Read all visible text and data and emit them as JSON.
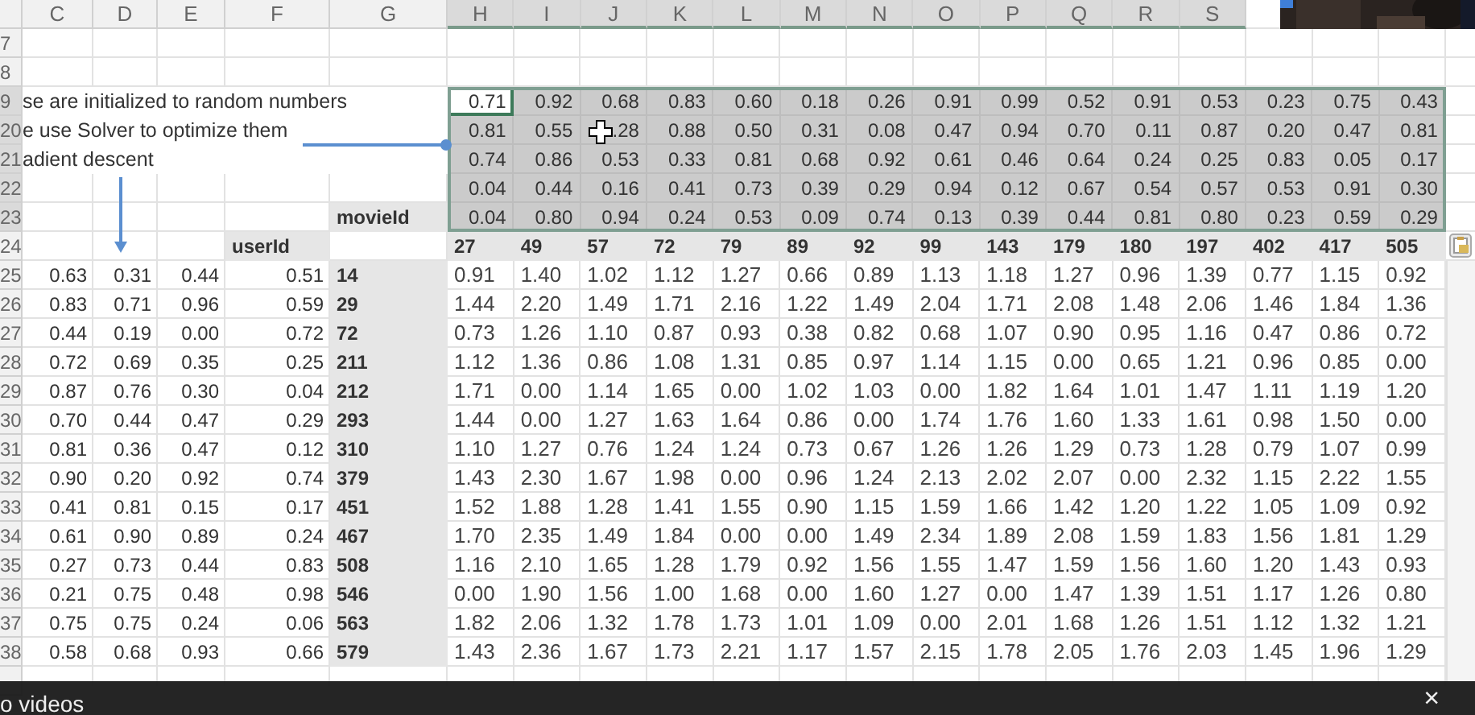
{
  "sheet": {
    "column_headers": [
      {
        "label": "C",
        "highlighted": false
      },
      {
        "label": "D",
        "highlighted": false
      },
      {
        "label": "E",
        "highlighted": false
      },
      {
        "label": "F",
        "highlighted": false
      },
      {
        "label": "G",
        "highlighted": false
      },
      {
        "label": "H",
        "highlighted": true
      },
      {
        "label": "I",
        "highlighted": true
      },
      {
        "label": "J",
        "highlighted": true
      },
      {
        "label": "K",
        "highlighted": true
      },
      {
        "label": "L",
        "highlighted": true
      },
      {
        "label": "M",
        "highlighted": true
      },
      {
        "label": "N",
        "highlighted": true
      },
      {
        "label": "O",
        "highlighted": true
      },
      {
        "label": "P",
        "highlighted": true
      },
      {
        "label": "Q",
        "highlighted": true
      },
      {
        "label": "R",
        "highlighted": true
      },
      {
        "label": "S",
        "highlighted": true
      }
    ],
    "row_headers": [
      {
        "label": "7",
        "highlighted": false
      },
      {
        "label": "8",
        "highlighted": false
      },
      {
        "label": "9",
        "highlighted": true
      },
      {
        "label": "20",
        "highlighted": true
      },
      {
        "label": "21",
        "highlighted": true
      },
      {
        "label": "22",
        "highlighted": true
      },
      {
        "label": "23",
        "highlighted": true
      },
      {
        "label": "24",
        "highlighted": false
      },
      {
        "label": "25",
        "highlighted": false
      },
      {
        "label": "26",
        "highlighted": false
      },
      {
        "label": "27",
        "highlighted": false
      },
      {
        "label": "28",
        "highlighted": false
      },
      {
        "label": "29",
        "highlighted": false
      },
      {
        "label": "30",
        "highlighted": false
      },
      {
        "label": "31",
        "highlighted": false
      },
      {
        "label": "32",
        "highlighted": false
      },
      {
        "label": "33",
        "highlighted": false
      },
      {
        "label": "34",
        "highlighted": false
      },
      {
        "label": "35",
        "highlighted": false
      },
      {
        "label": "36",
        "highlighted": false
      },
      {
        "label": "37",
        "highlighted": false
      },
      {
        "label": "38",
        "highlighted": false
      }
    ],
    "notes": [
      "se are initialized to random numbers",
      "e use Solver to optimize them",
      "adient descent"
    ],
    "movie_factor_rows": [
      [
        {
          "value": "0.71",
          "selected": true
        },
        {
          "value": "0.92",
          "selected": false
        },
        {
          "value": "0.68",
          "selected": false
        },
        {
          "value": "0.83",
          "selected": false
        },
        {
          "value": "0.60",
          "selected": false
        },
        {
          "value": "0.18",
          "selected": false
        },
        {
          "value": "0.26",
          "selected": false
        },
        {
          "value": "0.91",
          "selected": false
        },
        {
          "value": "0.99",
          "selected": false
        },
        {
          "value": "0.52",
          "selected": false
        },
        {
          "value": "0.91",
          "selected": false
        },
        {
          "value": "0.53",
          "selected": false
        },
        {
          "value": "0.23",
          "selected": false
        },
        {
          "value": "0.75",
          "selected": false
        },
        {
          "value": "0.43",
          "selected": false
        }
      ],
      [
        {
          "value": "0.81",
          "selected": false
        },
        {
          "value": "0.55",
          "selected": false
        },
        {
          "value": ".28",
          "selected": false
        },
        {
          "value": "0.88",
          "selected": false
        },
        {
          "value": "0.50",
          "selected": false
        },
        {
          "value": "0.31",
          "selected": false
        },
        {
          "value": "0.08",
          "selected": false
        },
        {
          "value": "0.47",
          "selected": false
        },
        {
          "value": "0.94",
          "selected": false
        },
        {
          "value": "0.70",
          "selected": false
        },
        {
          "value": "0.11",
          "selected": false
        },
        {
          "value": "0.87",
          "selected": false
        },
        {
          "value": "0.20",
          "selected": false
        },
        {
          "value": "0.47",
          "selected": false
        },
        {
          "value": "0.81",
          "selected": false
        }
      ],
      [
        {
          "value": "0.74",
          "selected": false
        },
        {
          "value": "0.86",
          "selected": false
        },
        {
          "value": "0.53",
          "selected": false
        },
        {
          "value": "0.33",
          "selected": false
        },
        {
          "value": "0.81",
          "selected": false
        },
        {
          "value": "0.68",
          "selected": false
        },
        {
          "value": "0.92",
          "selected": false
        },
        {
          "value": "0.61",
          "selected": false
        },
        {
          "value": "0.46",
          "selected": false
        },
        {
          "value": "0.64",
          "selected": false
        },
        {
          "value": "0.24",
          "selected": false
        },
        {
          "value": "0.25",
          "selected": false
        },
        {
          "value": "0.83",
          "selected": false
        },
        {
          "value": "0.05",
          "selected": false
        },
        {
          "value": "0.17",
          "selected": false
        }
      ],
      [
        {
          "value": "0.04",
          "selected": false
        },
        {
          "value": "0.44",
          "selected": false
        },
        {
          "value": "0.16",
          "selected": false
        },
        {
          "value": "0.41",
          "selected": false
        },
        {
          "value": "0.73",
          "selected": false
        },
        {
          "value": "0.39",
          "selected": false
        },
        {
          "value": "0.29",
          "selected": false
        },
        {
          "value": "0.94",
          "selected": false
        },
        {
          "value": "0.12",
          "selected": false
        },
        {
          "value": "0.67",
          "selected": false
        },
        {
          "value": "0.54",
          "selected": false
        },
        {
          "value": "0.57",
          "selected": false
        },
        {
          "value": "0.53",
          "selected": false
        },
        {
          "value": "0.91",
          "selected": false
        },
        {
          "value": "0.30",
          "selected": false
        }
      ],
      [
        {
          "value": "0.04",
          "selected": false
        },
        {
          "value": "0.80",
          "selected": false
        },
        {
          "value": "0.94",
          "selected": false
        },
        {
          "value": "0.24",
          "selected": false
        },
        {
          "value": "0.53",
          "selected": false
        },
        {
          "value": "0.09",
          "selected": false
        },
        {
          "value": "0.74",
          "selected": false
        },
        {
          "value": "0.13",
          "selected": false
        },
        {
          "value": "0.39",
          "selected": false
        },
        {
          "value": "0.44",
          "selected": false
        },
        {
          "value": "0.81",
          "selected": false
        },
        {
          "value": "0.80",
          "selected": false
        },
        {
          "value": "0.23",
          "selected": false
        },
        {
          "value": "0.59",
          "selected": false
        },
        {
          "value": "0.29",
          "selected": false
        }
      ]
    ],
    "movie_label": "movieId",
    "user_label": "userId",
    "movie_ids": [
      "27",
      "49",
      "57",
      "72",
      "79",
      "89",
      "92",
      "99",
      "143",
      "179",
      "180",
      "197",
      "402",
      "417",
      "505"
    ],
    "users": [
      {
        "factors": [
          "0.63",
          "0.31",
          "0.44",
          "0.51"
        ],
        "id": "14",
        "predictions": [
          "0.91",
          "1.40",
          "1.02",
          "1.12",
          "1.27",
          "0.66",
          "0.89",
          "1.13",
          "1.18",
          "1.27",
          "0.96",
          "1.39",
          "0.77",
          "1.15",
          "0.92"
        ]
      },
      {
        "factors": [
          "0.83",
          "0.71",
          "0.96",
          "0.59"
        ],
        "id": "29",
        "predictions": [
          "1.44",
          "2.20",
          "1.49",
          "1.71",
          "2.16",
          "1.22",
          "1.49",
          "2.04",
          "1.71",
          "2.08",
          "1.48",
          "2.06",
          "1.46",
          "1.84",
          "1.36"
        ]
      },
      {
        "factors": [
          "0.44",
          "0.19",
          "0.00",
          "0.72"
        ],
        "id": "72",
        "predictions": [
          "0.73",
          "1.26",
          "1.10",
          "0.87",
          "0.93",
          "0.38",
          "0.82",
          "0.68",
          "1.07",
          "0.90",
          "0.95",
          "1.16",
          "0.47",
          "0.86",
          "0.72"
        ]
      },
      {
        "factors": [
          "0.72",
          "0.69",
          "0.35",
          "0.25"
        ],
        "id": "211",
        "predictions": [
          "1.12",
          "1.36",
          "0.86",
          "1.08",
          "1.31",
          "0.85",
          "0.97",
          "1.14",
          "1.15",
          "0.00",
          "0.65",
          "1.21",
          "0.96",
          "0.85",
          "0.00"
        ]
      },
      {
        "factors": [
          "0.87",
          "0.76",
          "0.30",
          "0.04"
        ],
        "id": "212",
        "predictions": [
          "1.71",
          "0.00",
          "1.14",
          "1.65",
          "0.00",
          "1.02",
          "1.03",
          "0.00",
          "1.82",
          "1.64",
          "1.01",
          "1.47",
          "1.11",
          "1.19",
          "1.20"
        ]
      },
      {
        "factors": [
          "0.70",
          "0.44",
          "0.47",
          "0.29"
        ],
        "id": "293",
        "predictions": [
          "1.44",
          "0.00",
          "1.27",
          "1.63",
          "1.64",
          "0.86",
          "0.00",
          "1.74",
          "1.76",
          "1.60",
          "1.33",
          "1.61",
          "0.98",
          "1.50",
          "0.00"
        ]
      },
      {
        "factors": [
          "0.81",
          "0.36",
          "0.47",
          "0.12"
        ],
        "id": "310",
        "predictions": [
          "1.10",
          "1.27",
          "0.76",
          "1.24",
          "1.24",
          "0.73",
          "0.67",
          "1.26",
          "1.26",
          "1.29",
          "0.73",
          "1.28",
          "0.79",
          "1.07",
          "0.99"
        ]
      },
      {
        "factors": [
          "0.90",
          "0.20",
          "0.92",
          "0.74"
        ],
        "id": "379",
        "predictions": [
          "1.43",
          "2.30",
          "1.67",
          "1.98",
          "0.00",
          "0.96",
          "1.24",
          "2.13",
          "2.02",
          "2.07",
          "0.00",
          "2.32",
          "1.15",
          "2.22",
          "1.55"
        ]
      },
      {
        "factors": [
          "0.41",
          "0.81",
          "0.15",
          "0.17"
        ],
        "id": "451",
        "predictions": [
          "1.52",
          "1.88",
          "1.28",
          "1.41",
          "1.55",
          "0.90",
          "1.15",
          "1.59",
          "1.66",
          "1.42",
          "1.20",
          "1.22",
          "1.05",
          "1.09",
          "0.92"
        ]
      },
      {
        "factors": [
          "0.61",
          "0.90",
          "0.89",
          "0.24"
        ],
        "id": "467",
        "predictions": [
          "1.70",
          "2.35",
          "1.49",
          "1.84",
          "0.00",
          "0.00",
          "1.49",
          "2.34",
          "1.89",
          "2.08",
          "1.59",
          "1.83",
          "1.56",
          "1.81",
          "1.29"
        ]
      },
      {
        "factors": [
          "0.27",
          "0.73",
          "0.44",
          "0.83"
        ],
        "id": "508",
        "predictions": [
          "1.16",
          "2.10",
          "1.65",
          "1.28",
          "1.79",
          "0.92",
          "1.56",
          "1.55",
          "1.47",
          "1.59",
          "1.56",
          "1.60",
          "1.20",
          "1.43",
          "0.93"
        ]
      },
      {
        "factors": [
          "0.21",
          "0.75",
          "0.48",
          "0.98"
        ],
        "id": "546",
        "predictions": [
          "0.00",
          "1.90",
          "1.56",
          "1.00",
          "1.68",
          "0.00",
          "1.60",
          "1.27",
          "0.00",
          "1.47",
          "1.39",
          "1.51",
          "1.17",
          "1.26",
          "0.80"
        ]
      },
      {
        "factors": [
          "0.75",
          "0.75",
          "0.24",
          "0.06"
        ],
        "id": "563",
        "predictions": [
          "1.82",
          "2.06",
          "1.32",
          "1.78",
          "1.73",
          "1.01",
          "1.09",
          "0.00",
          "2.01",
          "1.68",
          "1.26",
          "1.51",
          "1.12",
          "1.32",
          "1.21"
        ]
      },
      {
        "factors": [
          "0.58",
          "0.68",
          "0.93",
          "0.66"
        ],
        "id": "579",
        "predictions": [
          "1.43",
          "2.36",
          "1.67",
          "1.73",
          "2.21",
          "1.17",
          "1.57",
          "2.15",
          "1.78",
          "2.05",
          "1.76",
          "2.03",
          "1.45",
          "1.96",
          "1.29"
        ]
      }
    ]
  },
  "video_overlay": {
    "caption": "o videos",
    "close": "×"
  }
}
